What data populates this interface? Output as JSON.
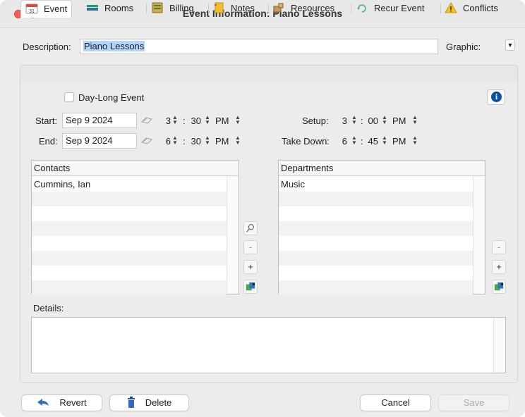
{
  "window": {
    "title": "Event Information: Piano Lessons"
  },
  "header": {
    "description_label": "Description:",
    "description_value": "Piano Lessons",
    "graphic_label": "Graphic:"
  },
  "tabs": [
    {
      "label": "Event",
      "icon": "calendar-icon",
      "active": true
    },
    {
      "label": "Rooms",
      "icon": "rooms-icon"
    },
    {
      "label": "Billing",
      "icon": "billing-icon"
    },
    {
      "label": "Notes",
      "icon": "notes-icon"
    },
    {
      "label": "Resources",
      "icon": "resources-icon"
    },
    {
      "label": "Recur Event",
      "icon": "recur-icon"
    },
    {
      "label": "Conflicts",
      "icon": "warning-icon"
    }
  ],
  "event": {
    "day_long_label": "Day-Long Event",
    "start_label": "Start:",
    "start_date": "Sep 9 2024",
    "start_hour": "3",
    "start_min": "30",
    "start_ampm": "PM",
    "end_label": "End:",
    "end_date": "Sep 9 2024",
    "end_hour": "6",
    "end_min": "30",
    "end_ampm": "PM",
    "setup_label": "Setup:",
    "setup_hour": "3",
    "setup_min": "00",
    "setup_ampm": "PM",
    "takedown_label": "Take Down:",
    "takedown_hour": "6",
    "takedown_min": "45",
    "takedown_ampm": "PM",
    "time_sep": ":"
  },
  "contacts": {
    "header": "Contacts",
    "rows": [
      "Cummins, Ian"
    ]
  },
  "departments": {
    "header": "Departments",
    "rows": [
      "Music"
    ]
  },
  "buttons": {
    "remove": "-",
    "add": "+"
  },
  "details": {
    "label": "Details:",
    "value": ""
  },
  "footer": {
    "revert": "Revert",
    "delete": "Delete",
    "cancel": "Cancel",
    "save": "Save"
  },
  "colors": {
    "close": "#ff5f57",
    "minimize": "#febc2e",
    "selection": "#b3d4fd",
    "info": "#0b4ea2"
  }
}
